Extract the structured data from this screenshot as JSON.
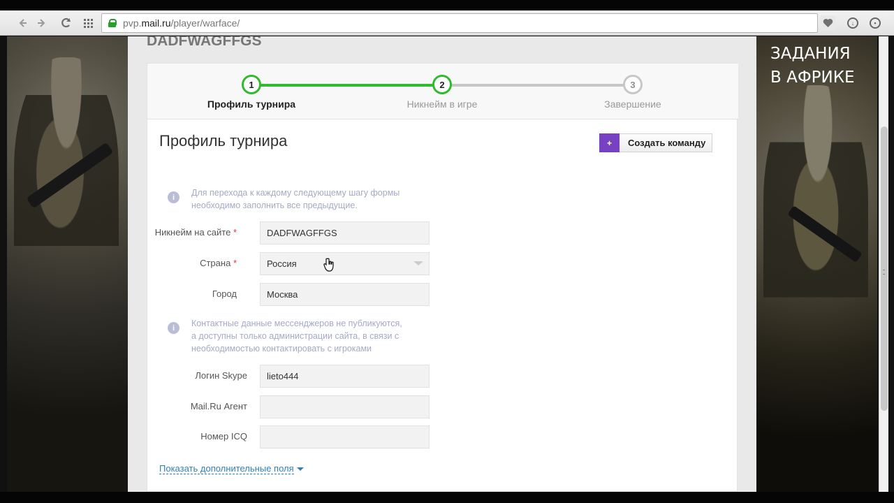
{
  "browser": {
    "url_prefix": "pvp.",
    "url_domain": "mail.ru",
    "url_path": "/player/warface/",
    "icons": {
      "back": "back-arrow-icon",
      "forward": "forward-arrow-icon",
      "reload": "reload-icon",
      "apps": "apps-grid-icon",
      "lock": "lock-icon",
      "heart": "heart-icon",
      "download": "download-icon",
      "profile": "profile-icon"
    }
  },
  "banner": {
    "right_title_line1": "ЗАДАНИЯ",
    "right_title_line2": "В АФРИКЕ"
  },
  "page": {
    "player_nick": "DADFWAGFFGS",
    "steps": [
      {
        "number": "1",
        "label": "Профиль турнира",
        "state": "current"
      },
      {
        "number": "2",
        "label": "Никнейм в игре",
        "state": "completed"
      },
      {
        "number": "3",
        "label": "Завершение",
        "state": "pending"
      }
    ],
    "section_title": "Профиль турнира",
    "create_team": {
      "icon": "+",
      "label": "Создать команду"
    },
    "info1": {
      "icon": "i",
      "line1": "Для перехода к каждому следующему шагу формы",
      "line2": "необходимо заполнить все предыдущие."
    },
    "info2": {
      "icon": "i",
      "line1": "Контактные данные мессенджеров не публикуются,",
      "line2": "а доступны только администрации сайта, в связи с",
      "line3": "необходимостью контактировать с игроками"
    },
    "fields": {
      "site_nick": {
        "label": "Никнейм на сайте",
        "required": "*",
        "value": "DADFWAGFFGS"
      },
      "country": {
        "label": "Страна",
        "required": "*",
        "value": "Россия"
      },
      "city": {
        "label": "Город",
        "value": "Москва"
      },
      "skype": {
        "label": "Логин Skype",
        "value": "lieto444"
      },
      "mail_agent": {
        "label": "Mail.Ru Агент",
        "value": ""
      },
      "icq": {
        "label": "Номер ICQ",
        "value": ""
      }
    },
    "show_more": "Показать дополнительные поля"
  },
  "colors": {
    "green": "#2fba2f",
    "purple": "#7841c4",
    "link": "#2d82bd",
    "required": "#dc3d3d"
  }
}
